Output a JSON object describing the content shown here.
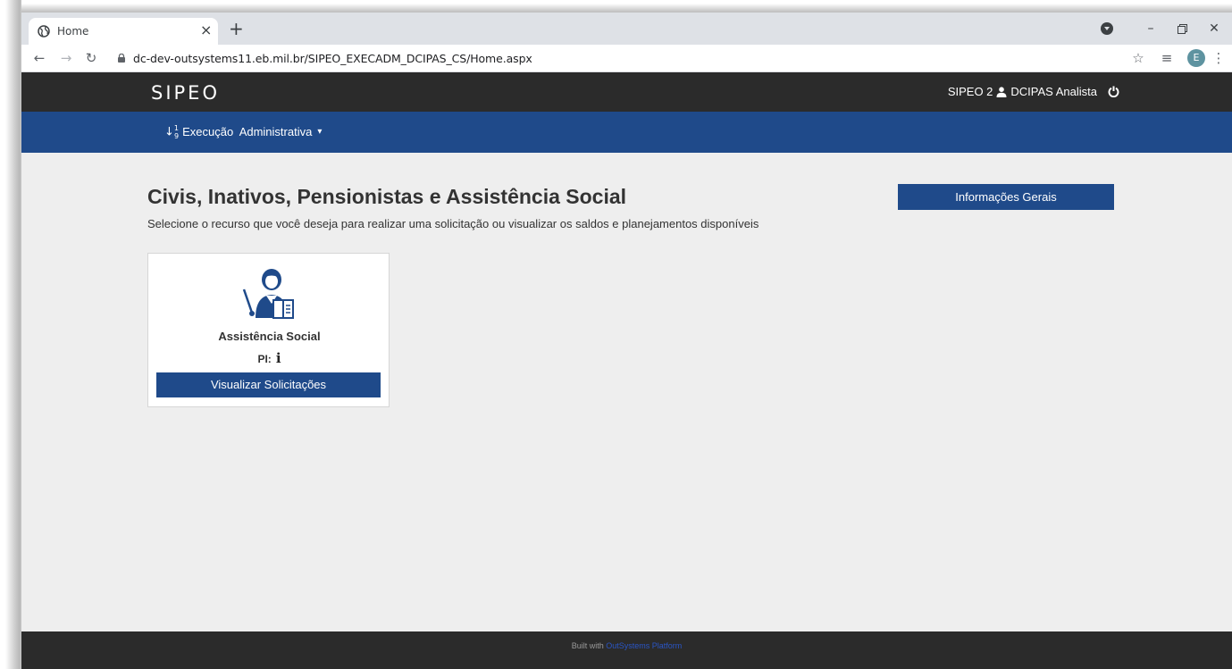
{
  "browser": {
    "tab_title": "Home",
    "tab_close": "×",
    "new_tab": "+",
    "url": "dc-dev-outsystems11.eb.mil.br/SIPEO_EXECADM_DCIPAS_CS/Home.aspx",
    "profile_initial": "E",
    "window_controls": [
      "minimize-icon",
      "restore-icon",
      "close-icon"
    ]
  },
  "header": {
    "logo": "SIPEO",
    "system": "SIPEO 2",
    "user": "DCIPAS Analista"
  },
  "menu": {
    "item_label": "Execução  Administrativa"
  },
  "main": {
    "title": "Civis, Inativos, Pensionistas e Assistência Social",
    "subtitle": "Selecione o recurso que você deseja para realizar uma solicitação ou visualizar os saldos e planejamentos disponíveis",
    "info_button": "Informações Gerais",
    "cards": [
      {
        "title": "Assistência Social",
        "pi_label": "PI:",
        "pi_icon": "i",
        "button": "Visualizar Solicitações"
      }
    ]
  },
  "footer": {
    "prefix": "Built with",
    "link": "OutSystems Platform"
  },
  "colors": {
    "primary_blue": "#1f4a8a",
    "header_dark": "#2b2b2b",
    "page_bg": "#eeeeee"
  }
}
